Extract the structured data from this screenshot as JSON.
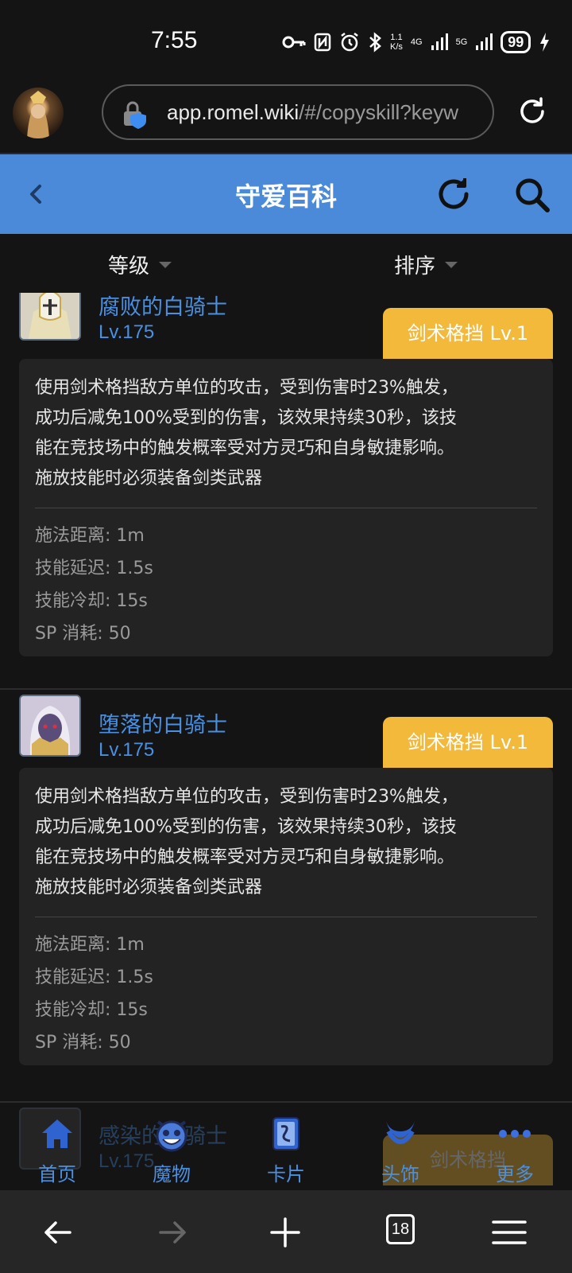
{
  "status": {
    "time": "7:55",
    "net_speed_top": "1.1",
    "net_speed_bottom": "K/s",
    "net1": "4G",
    "net2": "5G",
    "battery": "99"
  },
  "browser": {
    "url_host": "app.romel.wiki",
    "url_path": "/#/copyskill?keyw"
  },
  "header": {
    "title": "守爱百科"
  },
  "filters": {
    "level": "等级",
    "sort": "排序"
  },
  "entries": [
    {
      "name": "腐败的白骑士",
      "level": "Lv.175",
      "tag": "剑术格挡  Lv.1",
      "desc_lines": [
        "使用剑术格挡敌方单位的攻击，受到伤害时23%触发，",
        "成功后减免100%受到的伤害，该效果持续30秒，该技",
        "能在竞技场中的触发概率受对方灵巧和自身敏捷影响。",
        "施放技能时必须装备剑类武器"
      ],
      "stats": [
        "施法距离: 1m",
        "技能延迟: 1.5s",
        "技能冷却: 15s",
        "SP 消耗: 50"
      ]
    },
    {
      "name": "堕落的白骑士",
      "level": "Lv.175",
      "tag": "剑术格挡  Lv.1",
      "desc_lines": [
        "使用剑术格挡敌方单位的攻击，受到伤害时23%触发，",
        "成功后减免100%受到的伤害，该效果持续30秒，该技",
        "能在竞技场中的触发概率受对方灵巧和自身敏捷影响。",
        "施放技能时必须装备剑类武器"
      ],
      "stats": [
        "施法距离: 1m",
        "技能延迟: 1.5s",
        "技能冷却: 15s",
        "SP 消耗: 50"
      ]
    },
    {
      "name": "感染的白骑士",
      "level": "Lv.175",
      "tag": "剑术格挡"
    }
  ],
  "nav": [
    {
      "label": "首页",
      "icon": "home-icon"
    },
    {
      "label": "魔物",
      "icon": "monster-icon"
    },
    {
      "label": "卡片",
      "icon": "card-icon"
    },
    {
      "label": "头饰",
      "icon": "headwear-icon"
    },
    {
      "label": "更多",
      "icon": "more-icon"
    }
  ],
  "toolbar": {
    "tab_count": "18"
  },
  "colors": {
    "accent": "#4a8ad8",
    "tag": "#f2b93b",
    "link": "#4a90e2"
  }
}
